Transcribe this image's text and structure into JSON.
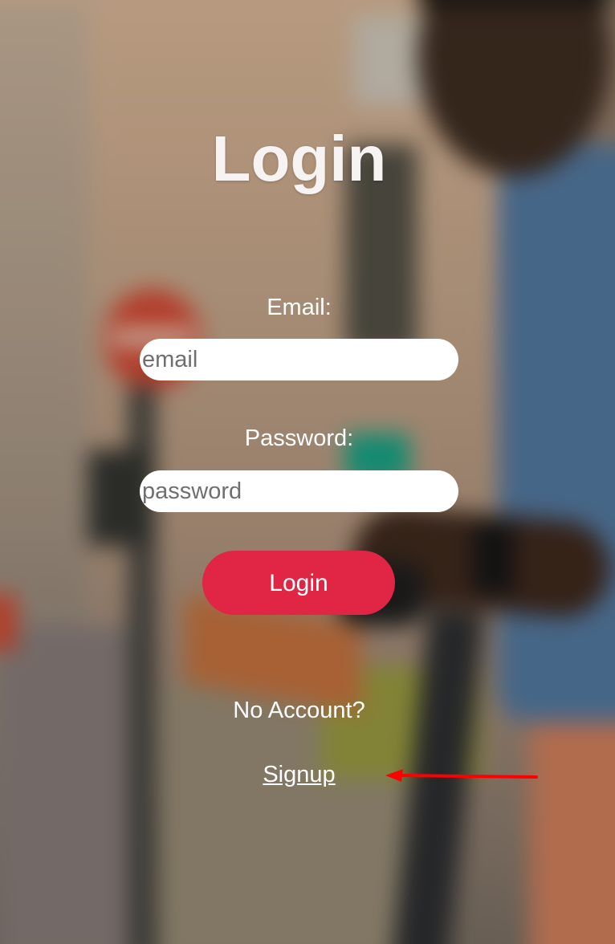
{
  "page": {
    "title": "Login"
  },
  "form": {
    "email_label": "Email:",
    "email_placeholder": "email",
    "email_value": "",
    "password_label": "Password:",
    "password_placeholder": "password",
    "password_value": "",
    "submit_label": "Login"
  },
  "footer": {
    "no_account_text": "No Account?",
    "signup_link": "Signup"
  },
  "colors": {
    "button": "#e02545",
    "text": "#ffffff",
    "annotation_arrow": "#ff0000"
  },
  "icons": {
    "annotation": "red-arrow-icon"
  }
}
